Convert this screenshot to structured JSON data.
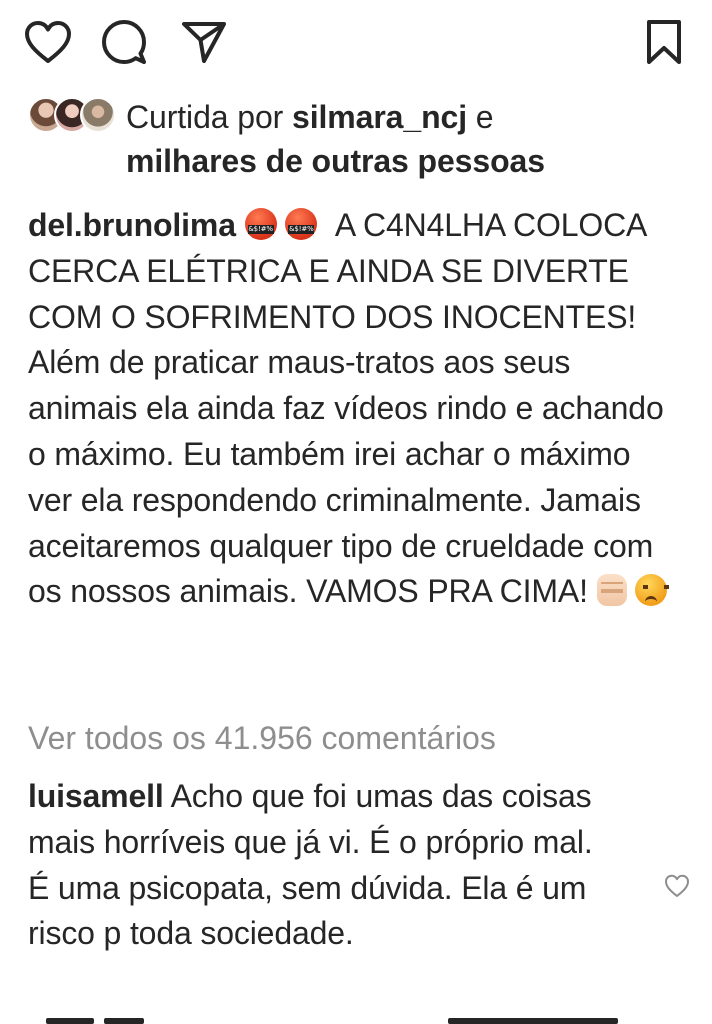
{
  "actions": {
    "like_icon": "heart-outline-icon",
    "comment_icon": "comment-bubble-icon",
    "share_icon": "paper-plane-icon",
    "save_icon": "bookmark-outline-icon"
  },
  "likes": {
    "prefix": "Curtida por ",
    "username": "silmara_ncj",
    "middle": " e",
    "others": "milhares de outras pessoas"
  },
  "caption": {
    "username": "del.brunolima",
    "emoji_1": "cursing-face-emoji",
    "emoji_2": "cursing-face-emoji",
    "text": "A C4N4LHA COLOCA CERCA ELÉTRICA E AINDA SE DIVERTE COM O SOFRIMENTO DOS INOCENTES! Além de praticar maus-tratos aos seus animais ela ainda faz vídeos rindo e achando o máximo. Eu também irei achar o máximo ver ela respondendo criminalmente. Jamais aceitaremos qualquer tipo de crueldade com os nossos animais. VAMOS PRA CIMA!",
    "emoji_3": "raised-fist-emoji",
    "emoji_4": "angry-face-emoji"
  },
  "view_all_comments": "Ver todos os 41.956 comentários",
  "comment": {
    "username": "luisamell",
    "text": "Acho que foi umas das coisas mais horríveis que já vi. É o próprio mal. É uma psicopata, sem dúvida. Ela é um risco p toda sociedade.",
    "like_icon": "heart-outline-small-icon"
  },
  "colors": {
    "text": "#262626",
    "secondary_text": "#8e8e8e",
    "background": "#ffffff"
  }
}
